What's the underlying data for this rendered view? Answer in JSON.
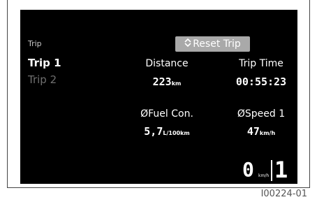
{
  "menu": {
    "header": "Trip",
    "items": [
      {
        "label": "Trip 1",
        "selected": true
      },
      {
        "label": "Trip 2",
        "selected": false
      }
    ]
  },
  "reset_button": {
    "label": "Reset Trip",
    "icon": "up-down-arrow-icon"
  },
  "stats": {
    "distance": {
      "label": "Distance",
      "value": "223",
      "unit": "km"
    },
    "trip_time": {
      "label": "Trip Time",
      "value": "00:55:23"
    },
    "fuel": {
      "label": "ØFuel Con.",
      "value": "5,7",
      "unit": "L/100km"
    },
    "speed": {
      "label": "ØSpeed 1",
      "value": "47",
      "unit": "km/h"
    }
  },
  "status_bar": {
    "speed_value": "0",
    "speed_unit": "km/h",
    "gear": "1"
  },
  "figure_id": "I00224-01",
  "colors": {
    "screen_bg": "#000000",
    "button_bg": "#a9a9a9",
    "inactive_text": "#6f6f6f"
  }
}
